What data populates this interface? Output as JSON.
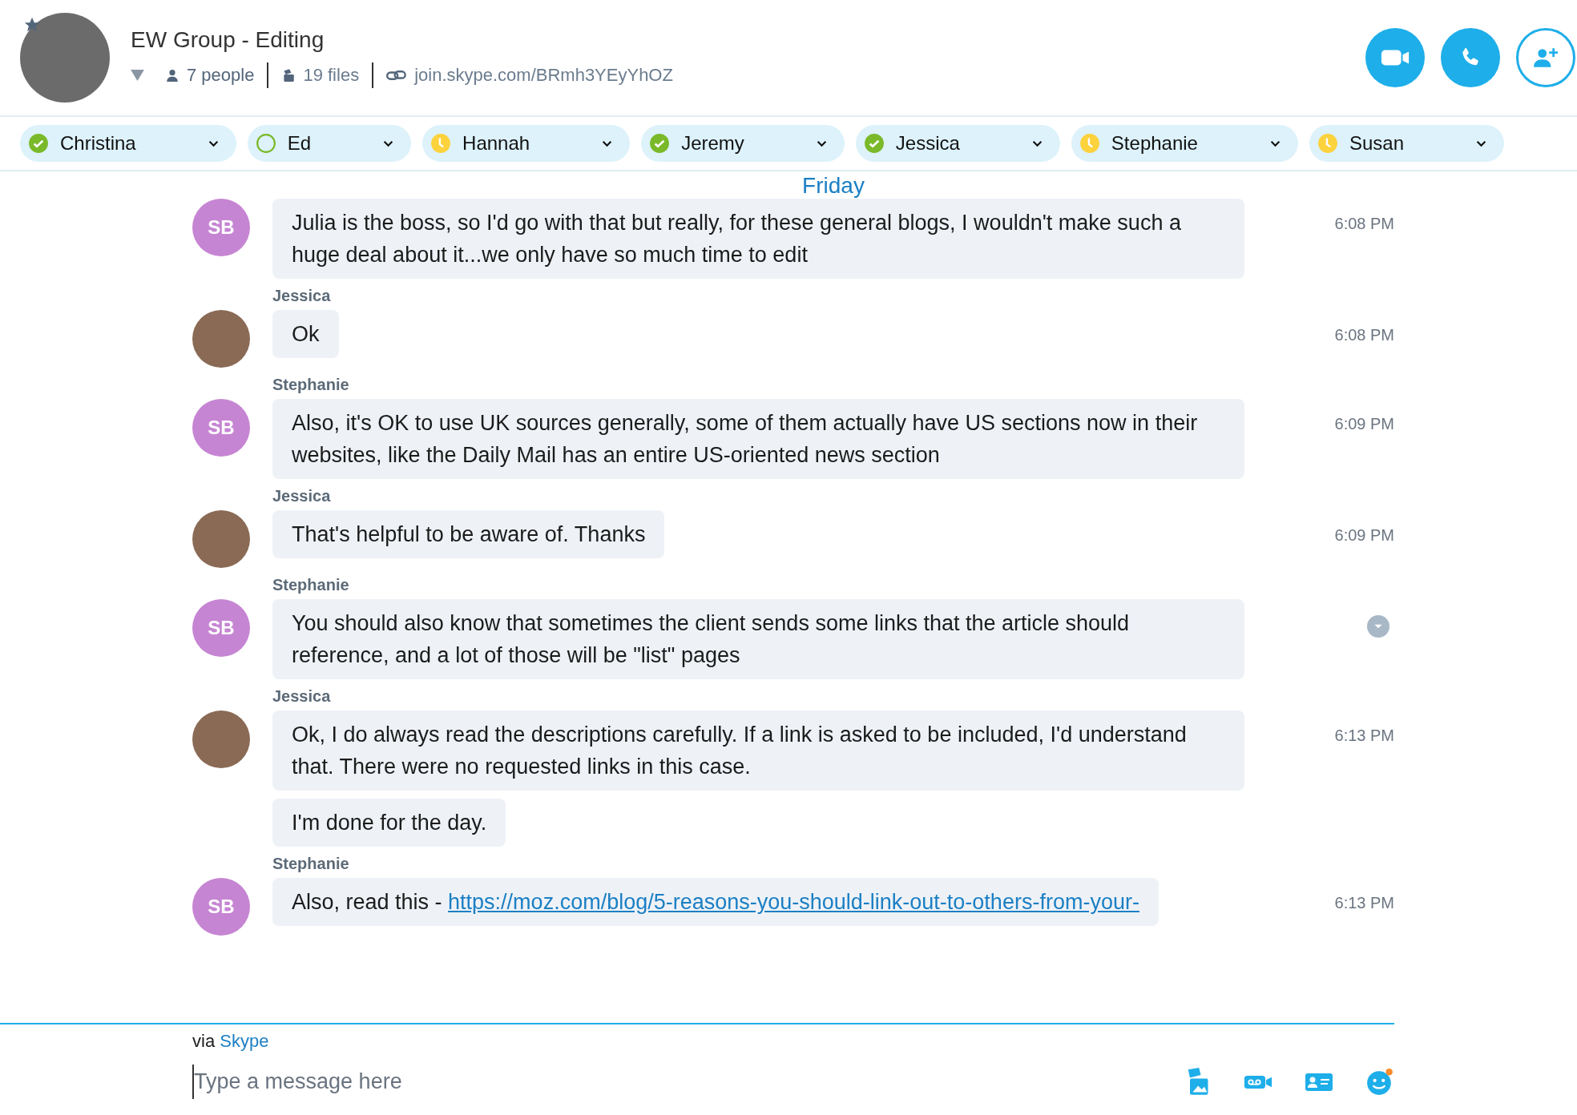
{
  "header": {
    "title": "EW Group - Editing",
    "people": "7 people",
    "files": "19 files",
    "link": "join.skype.com/BRmh3YEyYhOZ"
  },
  "participants": [
    {
      "name": "Christina",
      "kind": "online"
    },
    {
      "name": "Ed",
      "kind": "offline"
    },
    {
      "name": "Hannah",
      "kind": "away"
    },
    {
      "name": "Jeremy",
      "kind": "online"
    },
    {
      "name": "Jessica",
      "kind": "online"
    },
    {
      "name": "Stephanie",
      "kind": "away"
    },
    {
      "name": "Susan",
      "kind": "away"
    }
  ],
  "day_divider": "Friday",
  "messages": [
    {
      "kind": "initials",
      "initials": "SB",
      "bubbles": [
        {
          "text": "Julia is the boss, so I'd go with that but really, for these general blogs, I wouldn't make such a huge deal about it...we only have so much time to edit",
          "time": "6:08 PM",
          "menu": false
        }
      ]
    },
    {
      "sender": "Jessica",
      "kind": "photo",
      "bubbles": [
        {
          "text": "Ok",
          "time": "6:08 PM",
          "menu": false
        }
      ]
    },
    {
      "sender": "Stephanie",
      "kind": "initials",
      "initials": "SB",
      "bubbles": [
        {
          "text": "Also, it's OK to use UK sources generally, some of them actually have US sections now in their websites, like the Daily Mail has an entire US-oriented news section",
          "time": "6:09 PM",
          "menu": false
        }
      ]
    },
    {
      "sender": "Jessica",
      "kind": "photo",
      "bubbles": [
        {
          "text": "That's helpful to be aware of. Thanks",
          "time": "6:09 PM",
          "menu": false
        }
      ]
    },
    {
      "sender": "Stephanie",
      "kind": "initials",
      "initials": "SB",
      "bubbles": [
        {
          "text": "You should also know that sometimes the client sends some links that the article should reference, and a lot of those will be \"list\" pages",
          "menu": true
        }
      ]
    },
    {
      "sender": "Jessica",
      "kind": "photo",
      "bubbles": [
        {
          "text": "Ok, I do always read the descriptions carefully. If a link is asked to be included, I'd understand that. There were no requested links in this case.",
          "time": "6:13 PM",
          "menu": false
        },
        {
          "text": "I'm done for the day.",
          "menu": false
        }
      ]
    },
    {
      "sender": "Stephanie",
      "kind": "initials",
      "initials": "SB",
      "bubbles": [
        {
          "text": "Also, read this - ",
          "link": "https://moz.com/blog/5-reasons-you-should-link-out-to-others-from-your-",
          "time": "6:13 PM",
          "menu": false
        }
      ]
    }
  ],
  "composer": {
    "via": "via",
    "via_link": "Skype",
    "placeholder": "Type a message here"
  }
}
